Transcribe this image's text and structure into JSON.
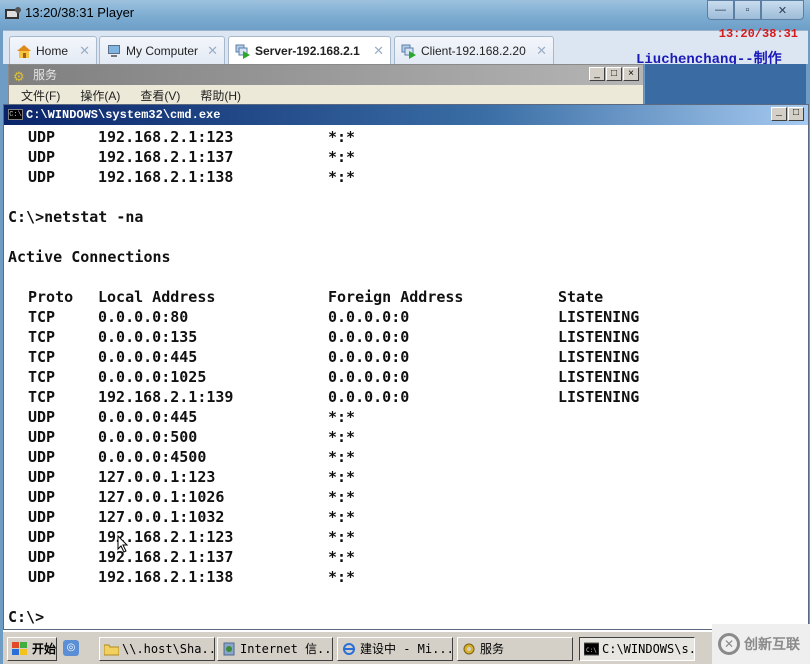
{
  "player": {
    "title": "13:20/38:31 Player",
    "timer": "13:20/38:31",
    "author": "Liuchenchang--制作",
    "controls": {
      "minimize": "—",
      "maximize": "▫",
      "close": "✕"
    }
  },
  "tabs": [
    {
      "label": "Home",
      "icon": "home-icon",
      "active": false
    },
    {
      "label": "My Computer",
      "icon": "computer-icon",
      "active": false
    },
    {
      "label": "Server-192.168.2.1",
      "icon": "vm-running-icon",
      "active": true
    },
    {
      "label": "Client-192.168.2.20",
      "icon": "vm-icon",
      "active": false
    }
  ],
  "tab_close_glyph": "✕",
  "services_window": {
    "title": "服务",
    "menu": [
      "文件(F)",
      "操作(A)",
      "查看(V)",
      "帮助(H)"
    ],
    "controls": {
      "minimize": "_",
      "maximize": "□",
      "close": "×"
    }
  },
  "cmd_window": {
    "title": "C:\\WINDOWS\\system32\\cmd.exe",
    "icon_text": "C:\\",
    "controls": {
      "minimize": "_",
      "maximize": "□"
    }
  },
  "console": {
    "top_rows": [
      {
        "proto": "UDP",
        "local": "192.168.2.1:123",
        "foreign": "*:*",
        "state": ""
      },
      {
        "proto": "UDP",
        "local": "192.168.2.1:137",
        "foreign": "*:*",
        "state": ""
      },
      {
        "proto": "UDP",
        "local": "192.168.2.1:138",
        "foreign": "*:*",
        "state": ""
      }
    ],
    "command": "C:\\>netstat -na",
    "heading": "Active Connections",
    "headers": {
      "proto": "Proto",
      "local": "Local Address",
      "foreign": "Foreign Address",
      "state": "State"
    },
    "rows": [
      {
        "proto": "TCP",
        "local": "0.0.0.0:80",
        "foreign": "0.0.0.0:0",
        "state": "LISTENING"
      },
      {
        "proto": "TCP",
        "local": "0.0.0.0:135",
        "foreign": "0.0.0.0:0",
        "state": "LISTENING"
      },
      {
        "proto": "TCP",
        "local": "0.0.0.0:445",
        "foreign": "0.0.0.0:0",
        "state": "LISTENING"
      },
      {
        "proto": "TCP",
        "local": "0.0.0.0:1025",
        "foreign": "0.0.0.0:0",
        "state": "LISTENING"
      },
      {
        "proto": "TCP",
        "local": "192.168.2.1:139",
        "foreign": "0.0.0.0:0",
        "state": "LISTENING"
      },
      {
        "proto": "UDP",
        "local": "0.0.0.0:445",
        "foreign": "*:*",
        "state": ""
      },
      {
        "proto": "UDP",
        "local": "0.0.0.0:500",
        "foreign": "*:*",
        "state": ""
      },
      {
        "proto": "UDP",
        "local": "0.0.0.0:4500",
        "foreign": "*:*",
        "state": ""
      },
      {
        "proto": "UDP",
        "local": "127.0.0.1:123",
        "foreign": "*:*",
        "state": ""
      },
      {
        "proto": "UDP",
        "local": "127.0.0.1:1026",
        "foreign": "*:*",
        "state": ""
      },
      {
        "proto": "UDP",
        "local": "127.0.0.1:1032",
        "foreign": "*:*",
        "state": ""
      },
      {
        "proto": "UDP",
        "local": "192.168.2.1:123",
        "foreign": "*:*",
        "state": ""
      },
      {
        "proto": "UDP",
        "local": "192.168.2.1:137",
        "foreign": "*:*",
        "state": ""
      },
      {
        "proto": "UDP",
        "local": "192.168.2.1:138",
        "foreign": "*:*",
        "state": ""
      }
    ],
    "prompt": "C:\\>"
  },
  "taskbar": {
    "start_label": "开始",
    "items": [
      {
        "label": "\\\\.host\\Sha...",
        "icon": "folder-icon",
        "pressed": false
      },
      {
        "label": "Internet 信...",
        "icon": "iis-icon",
        "pressed": false
      },
      {
        "label": "建设中 - Mi...",
        "icon": "ie-icon",
        "pressed": false
      },
      {
        "label": "服务",
        "icon": "services-gear-icon",
        "pressed": false
      },
      {
        "label": "C:\\WINDOWS\\s...",
        "icon": "cmd-icon",
        "pressed": true
      }
    ]
  },
  "watermark": {
    "text": "创新互联"
  }
}
